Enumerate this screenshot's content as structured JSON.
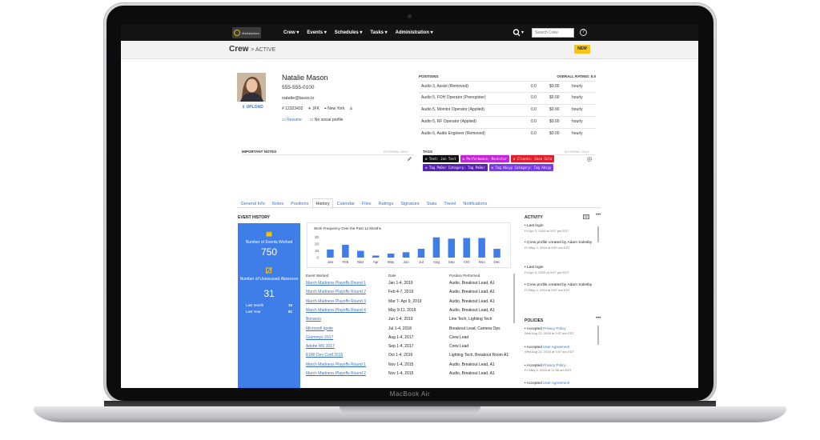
{
  "device": {
    "model": "MacBook Air"
  },
  "nav": {
    "logo_text": "Marketplace",
    "menu": [
      "Crew ▾",
      "Events ▾",
      "Schedules ▾",
      "Tasks ▾",
      "Administration ▾"
    ],
    "search_placeholder": "Search Crew",
    "help": "?"
  },
  "header": {
    "title": "Crew",
    "subtitle": "> ACTIVE",
    "new_label": "NEW"
  },
  "profile": {
    "upload_label": "UPLOAD",
    "name": "Natalie Mason",
    "phone": "555-555-0100",
    "email": "natalie@lasso.io",
    "id": "12323432",
    "airport": "JFK",
    "city": "New York",
    "resume": "Resume",
    "social": "No social profile"
  },
  "positions": {
    "header": "POSITIONS",
    "rating_label": "OVERALL RATING: 5.0",
    "rows": [
      {
        "name": "Audio 3, Assist (Removed)",
        "score": "0.0",
        "rate": "$0.00",
        "unit": "hourly"
      },
      {
        "name": "Audio 5, FOH Operator (Preregister)",
        "score": "0.0",
        "rate": "$0.00",
        "unit": "hourly"
      },
      {
        "name": "Audio 5, Monitor Operator (Applied)",
        "score": "0.0",
        "rate": "$0.00",
        "unit": "hourly"
      },
      {
        "name": "Audio 5, RF Operator (Applied)",
        "score": "0.0",
        "rate": "$0.00",
        "unit": "hourly"
      },
      {
        "name": "Audio 6, Audio Engineer (Removed)",
        "score": "0.0",
        "rate": "$0.00",
        "unit": "hourly"
      }
    ]
  },
  "notes": {
    "label": "IMPORTANT NOTES",
    "internal": "INTERNAL ONLY"
  },
  "tags": {
    "label": "TAGS",
    "internal": "INTERNAL ONLY",
    "items": [
      {
        "text": "Text: Jon Test",
        "color": "#111111"
      },
      {
        "text": "Performance: Rockstar",
        "color": "#c026d3"
      },
      {
        "text": "Clients: Coca Cola",
        "color": "#e11d2e"
      },
      {
        "text": "Tag PeDor Category: Tag PeDor",
        "color": "#5b21b6"
      },
      {
        "text": "Tag Abcyy Category: Tag Abcyy",
        "color": "#7c3aed"
      }
    ]
  },
  "tabs": [
    "General Info",
    "Notes",
    "Positions",
    "History",
    "Calendar",
    "Files",
    "Ratings",
    "Signature",
    "Stats",
    "Travel",
    "Notifications"
  ],
  "active_tab": "History",
  "history": {
    "title": "EVENT HISTORY",
    "events_worked_label": "Number of Events Worked",
    "events_worked": "750",
    "absences_label": "Number of Unexcused Absences",
    "absences": "31",
    "last_month_label": "Last Month",
    "last_month": "15",
    "last_year_label": "Last Year",
    "last_year": "81"
  },
  "chart_data": {
    "type": "bar",
    "title": "Work Frequency Over the Past 12 Months",
    "categories": [
      "Jan",
      "Feb",
      "Mar",
      "Apr",
      "May",
      "Jun",
      "Jul",
      "Aug",
      "Sep",
      "Oct",
      "Nov",
      "Dec"
    ],
    "values": [
      12,
      19,
      10,
      3,
      6,
      8,
      13,
      30,
      28,
      29,
      29,
      13
    ],
    "yticks": [
      0,
      10,
      20,
      30
    ],
    "ylim": [
      0,
      32
    ],
    "color": "#3f7ee8"
  },
  "events": {
    "headers": [
      "Event Worked",
      "Date",
      "Position Performed"
    ],
    "rows": [
      {
        "name": "March Madness Playoffs Round 1",
        "date": "Jan 1-4, 2019",
        "position": "Audio, Breakout Lead, A1"
      },
      {
        "name": "March Madness Playoffs Round 2",
        "date": "Feb 4-7, 2019",
        "position": "Audio, Breakout Lead, A1"
      },
      {
        "name": "March Madness Playoffs Round 3",
        "date": "Mar 7- Apr 9, 2019",
        "position": "Audio, Breakout Lead, A1"
      },
      {
        "name": "March Madness Playoffs Round 4",
        "date": "May 9-11, 2019",
        "position": "Audio, Breakout Lead, A1"
      },
      {
        "name": "Bonaroo",
        "date": "Jun 1-4, 2019",
        "position": "Line Tech, Lighting Tech"
      },
      {
        "name": "Microsoft Ignite",
        "date": "Jul 1-4, 2018",
        "position": "Breakout Lead, Camera Ops"
      },
      {
        "name": "Grammys 2017",
        "date": "Aug 1-4, 2017",
        "position": "Crew Lead"
      },
      {
        "name": "Adobe MX 2017",
        "date": "Sep 1-4, 2017",
        "position": "Crew Lead"
      },
      {
        "name": "ESRI Dev Conf 2016",
        "date": "Oct 1-4, 2016",
        "position": "Lighting Tech, Breakout Room A1"
      },
      {
        "name": "March Madness Playoffs Round 1",
        "date": "Nov 1-4, 2015",
        "position": "Audio, Breakout Lead, A1"
      },
      {
        "name": "March Madness Playoffs Round 2",
        "date": "Nov 1-4, 2015",
        "position": "Audio, Breakout Lead, A1"
      }
    ]
  },
  "activity": {
    "title": "ACTIVITY",
    "more": "•••",
    "items": [
      {
        "text": "• Last login",
        "time": "Fri Apr 3, 2020 at 3:07 pm EDT"
      },
      {
        "text": "• Crew profile created by Adam Solesby",
        "time": "Fri May 4, 2018 at 9:57 am EDT"
      },
      {
        "text": "• Last login",
        "time": "Fri Apr 3, 2020 at 3:07 pm EDT"
      },
      {
        "text": "• Crew profile created by Adam Solesby",
        "time": "Fri May 4, 2018 at 9:57 am EDT"
      }
    ]
  },
  "policies": {
    "title": "POLICIES",
    "more": "•••",
    "items": [
      {
        "prefix": "• Accepted",
        "link": "Privacy Policy",
        "time": "Wed Aug 22, 2018 at 9:57 am EDT"
      },
      {
        "prefix": "• Accepted",
        "link": "User Agreement",
        "time": "Wed Aug 22, 2018 at 9:57 am EDT"
      },
      {
        "prefix": "• Accepted",
        "link": "Privacy Policy",
        "time": "Fri May 4, 2018 at 11:56 am EDT"
      },
      {
        "prefix": "• Accepted",
        "link": "User Agreement",
        "time": ""
      }
    ]
  }
}
